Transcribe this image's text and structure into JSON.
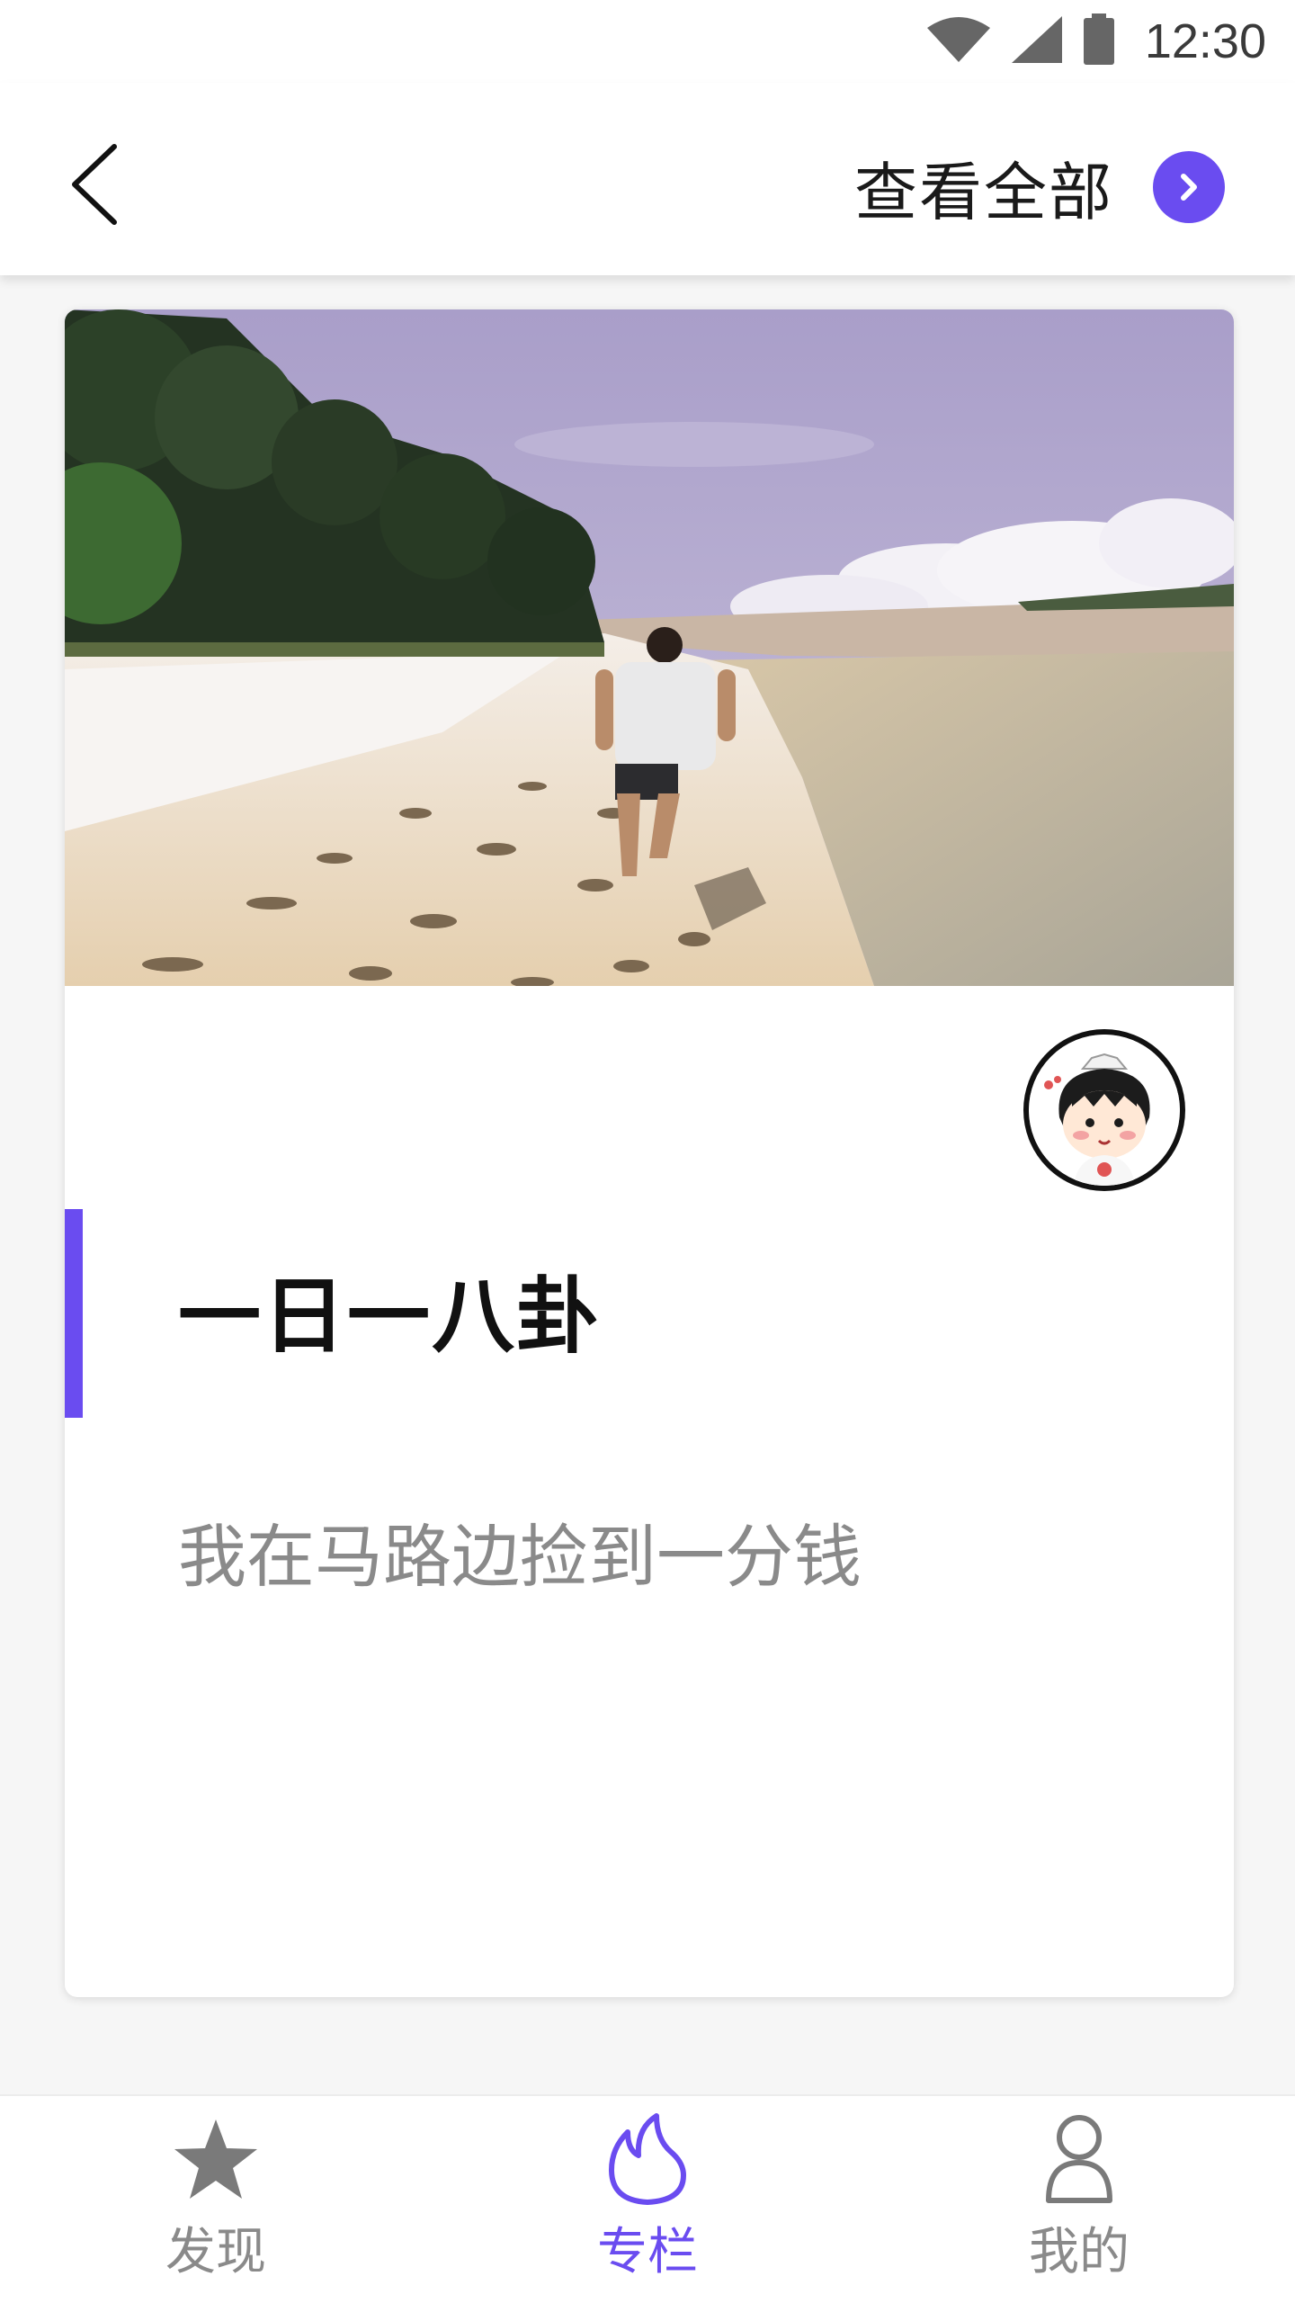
{
  "status_bar": {
    "time": "12:30"
  },
  "app_bar": {
    "view_all_label": "查看全部"
  },
  "card": {
    "title": "一日一八卦",
    "description": "我在马路边捡到一分钱"
  },
  "bottom_nav": {
    "items": [
      {
        "label": "发现",
        "icon": "star-icon",
        "active": false
      },
      {
        "label": "专栏",
        "icon": "flame-icon",
        "active": true
      },
      {
        "label": "我的",
        "icon": "person-icon",
        "active": false
      }
    ]
  },
  "colors": {
    "accent": "#6a4cf0",
    "inactive": "#8a8a8a",
    "text_primary": "#111111"
  }
}
